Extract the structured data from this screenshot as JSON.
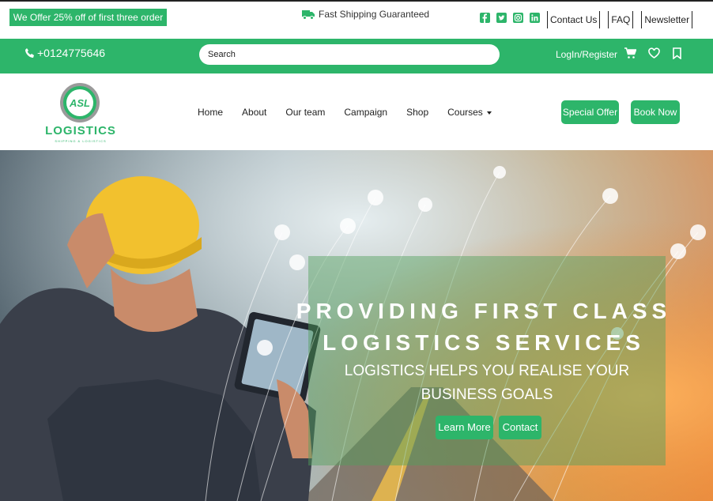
{
  "topbar": {
    "promo": "We Offer 25% off of first three order",
    "shipping": "Fast Shipping Guaranteed",
    "links": [
      "Contact Us",
      "FAQ",
      "Newsletter"
    ]
  },
  "greenbar": {
    "phone": "+0124775646",
    "search_placeholder": "Search",
    "login": "LogIn/Register"
  },
  "nav": {
    "logo_badge": "ASL",
    "logo_title": "LOGISTICS",
    "logo_subtitle": "SHIPPING & LOGISTICS",
    "items": [
      "Home",
      "About",
      "Our team",
      "Campaign",
      "Shop",
      "Courses"
    ],
    "special_offer": "Special Offer",
    "book_now": "Book Now"
  },
  "hero": {
    "title_line1": "PROVIDING FIRST CLASS",
    "title_line2": "LOGISTICS SERVICES",
    "subtitle_line1": "LOGISTICS HELPS YOU REALISE YOUR",
    "subtitle_line2": "BUSINESS GOALS",
    "learn_more": "Learn More",
    "contact": "Contact"
  },
  "colors": {
    "accent": "#2db56a"
  },
  "icons": [
    "truck-icon",
    "facebook-icon",
    "twitter-icon",
    "instagram-icon",
    "linkedin-icon",
    "phone-icon",
    "cart-icon",
    "heart-icon",
    "bookmark-icon"
  ]
}
